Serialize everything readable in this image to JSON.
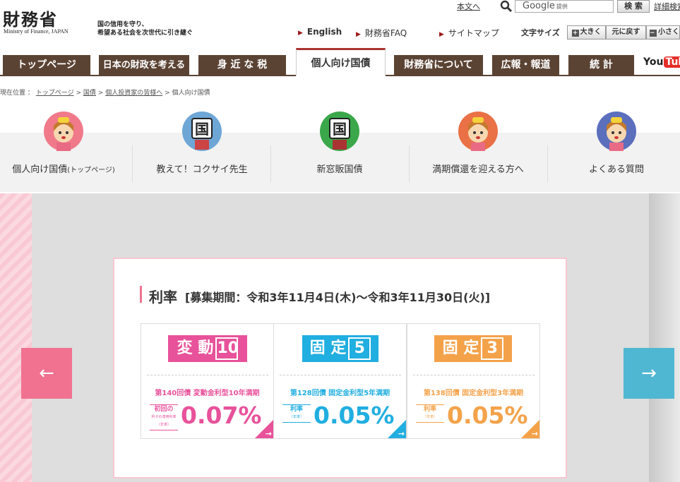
{
  "header": {
    "logo_kanji": "財務省",
    "logo_en": "Ministry of Finance, JAPAN",
    "slogan_line1": "国の信用を守り、",
    "slogan_line2": "希望ある社会を次世代に引き継ぐ",
    "honbun_link": "本文へ",
    "search_placeholder": "Google",
    "search_provided": "提供",
    "search_button": "検 索",
    "detail_search": "詳細検索",
    "links": [
      "English",
      "財務省FAQ",
      "サイトマップ"
    ],
    "font_size_label": "文字サイズ",
    "font_size_buttons": [
      "大きく",
      "元に戻す",
      "小さく"
    ]
  },
  "nav": {
    "tabs": [
      "トップページ",
      "日本の財政を考える",
      "身 近 な 税",
      "個人向け国債",
      "財務省について",
      "広報・報道",
      "統 計"
    ],
    "active_tab": "個人向け国債",
    "youtube_you": "You",
    "youtube_tube": "Tube"
  },
  "breadcrumb": {
    "prefix": "現在位置 ：",
    "items": [
      "トップページ",
      "国債",
      "個人投資家の皆様へ"
    ],
    "current": "個人向け国債",
    "sep": ">"
  },
  "subnav": {
    "items": [
      {
        "label": "個人向け国債",
        "suffix": "(トップページ)",
        "icon": "mascot-girl-icon",
        "color": "#f07a8a"
      },
      {
        "label": "教えて！コクサイ先生",
        "suffix": "",
        "icon": "kokusai-sensei-icon",
        "color": "#6ea6d6"
      },
      {
        "label": "新窓販国債",
        "suffix": "",
        "icon": "kokusai-green-icon",
        "color": "#3aa84a"
      },
      {
        "label": "満期償還を迎える方へ",
        "suffix": "",
        "icon": "mascot-girl-icon",
        "color": "#ea7045"
      },
      {
        "label": "よくある質問",
        "suffix": "",
        "icon": "mascot-girl-icon",
        "color": "#5b6fbd"
      }
    ]
  },
  "carousel": {
    "prev": "←",
    "next": "→",
    "rate_title": "利率",
    "rate_period": "[募集期間：令和3年11月4日(木)〜令和3年11月30日(火)]",
    "bonds": [
      {
        "logo_text": "変 動",
        "logo_num": "10",
        "series": "第140回債 変動金利型10年満期",
        "rate_label": "初回の",
        "rate_label2": "利子の適用利率",
        "rate_label3": "（年率）",
        "rate": "0.07%",
        "color": "#e8529a"
      },
      {
        "logo_text": "固 定",
        "logo_num": "5",
        "series": "第128回債 固定金利型5年満期",
        "rate_label": "利率",
        "rate_label2": "（年率）",
        "rate_label3": "",
        "rate": "0.05%",
        "color": "#21aee0"
      },
      {
        "logo_text": "固 定",
        "logo_num": "3",
        "series": "第138回債 固定金利型3年満期",
        "rate_label": "利率",
        "rate_label2": "（年率）",
        "rate_label3": "",
        "rate": "0.05%",
        "color": "#f4a24a"
      }
    ]
  }
}
